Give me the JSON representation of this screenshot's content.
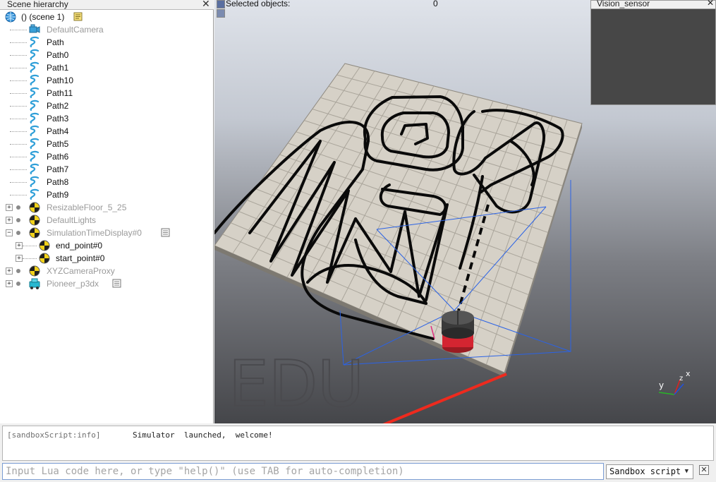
{
  "hierarchy": {
    "title": "Scene hierarchy",
    "close_glyph": "✕",
    "scene_label": "() (scene 1)",
    "items": [
      {
        "label": "DefaultCamera",
        "icon": "camera-icon",
        "dim": true
      },
      {
        "label": "Path",
        "icon": "path-icon"
      },
      {
        "label": "Path0",
        "icon": "path-icon"
      },
      {
        "label": "Path1",
        "icon": "path-icon"
      },
      {
        "label": "Path10",
        "icon": "path-icon"
      },
      {
        "label": "Path11",
        "icon": "path-icon"
      },
      {
        "label": "Path2",
        "icon": "path-icon"
      },
      {
        "label": "Path3",
        "icon": "path-icon"
      },
      {
        "label": "Path4",
        "icon": "path-icon"
      },
      {
        "label": "Path5",
        "icon": "path-icon"
      },
      {
        "label": "Path6",
        "icon": "path-icon"
      },
      {
        "label": "Path7",
        "icon": "path-icon"
      },
      {
        "label": "Path8",
        "icon": "path-icon"
      },
      {
        "label": "Path9",
        "icon": "path-icon"
      },
      {
        "label": "ResizableFloor_5_25",
        "icon": "dummy-icon",
        "dim": true
      },
      {
        "label": "DefaultLights",
        "icon": "dummy-icon",
        "dim": true
      },
      {
        "label": "SimulationTimeDisplay#0",
        "icon": "dummy-icon",
        "dim": true
      },
      {
        "label": "end_point#0",
        "icon": "dummy-icon"
      },
      {
        "label": "start_point#0",
        "icon": "dummy-icon"
      },
      {
        "label": "XYZCameraProxy",
        "icon": "dummy-icon",
        "dim": true
      },
      {
        "label": "Pioneer_p3dx",
        "icon": "robot-icon",
        "dim": true
      }
    ]
  },
  "viewport": {
    "selected_label": "Selected objects:",
    "selected_count": "0",
    "watermark": "EDU",
    "axes": {
      "x": "x",
      "y": "y",
      "z": "z"
    }
  },
  "vision_sensor": {
    "title": "Vision_sensor",
    "close_glyph": "✕"
  },
  "console": {
    "source": "[sandboxScript:info]",
    "message": "Simulator  launched,  welcome!"
  },
  "input": {
    "placeholder": "Input Lua code here, or type \"help()\" (use TAB for auto-completion)",
    "value": ""
  },
  "script_select": {
    "value": "Sandbox script",
    "arrow": "▼"
  },
  "close_glyph": "✕",
  "colors": {
    "floor": "#d6d1c7",
    "tile_line": "#aaa59b",
    "path": "#0a0a0a",
    "frustum": "#2b63e6",
    "annotation_arrow": "#ee2a1e",
    "robot_top": "#3a3a3a",
    "robot_base": "#d42531"
  }
}
